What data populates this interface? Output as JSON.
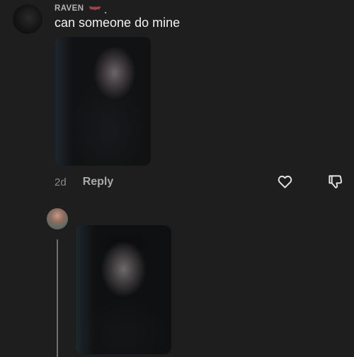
{
  "comment": {
    "username": "RAVEN",
    "username_suffix": ".",
    "username_emoji_icon": "bat-icon",
    "text": "can someone do mine",
    "image_description": "attached-photo",
    "time": "2d",
    "reply_label": "Reply",
    "like_icon": "heart-icon",
    "dislike_icon": "thumbs-down-icon"
  },
  "reply": {
    "avatar": "user-avatar",
    "image_description": "attached-photo"
  },
  "colors": {
    "background": "#1e1e1e",
    "text_primary": "#f2f2f2",
    "text_secondary": "#8a8a8a",
    "thread_line": "#6e6e6e"
  }
}
